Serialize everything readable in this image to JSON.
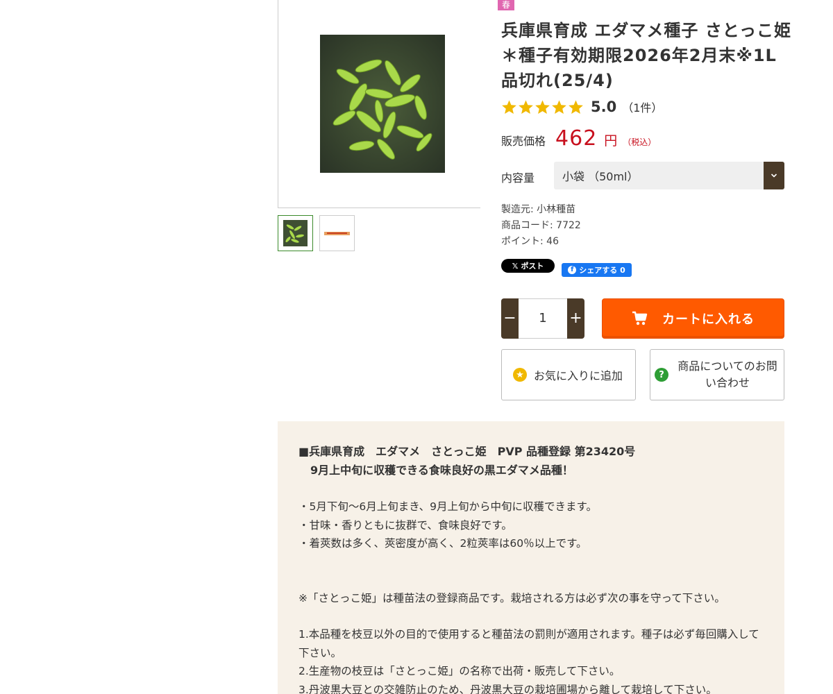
{
  "season_badge": "春",
  "product": {
    "title": "兵庫県育成 エダマメ種子 さとっこ姫＊種子有効期限2026年2月末※1L品切れ(25/4)",
    "rating": {
      "stars": 5,
      "score": "5.0",
      "count": "（1件）"
    },
    "price": {
      "label": "販売価格",
      "value": "462",
      "unit": "円",
      "tax": "（税込）"
    },
    "volume": {
      "label": "内容量",
      "selected": "小袋 （50ml）"
    },
    "maker": "製造元: 小林種苗",
    "code": "商品コード: 7722",
    "point": "ポイント: 46"
  },
  "social": {
    "x_post": "ポスト",
    "fb_share": "シェアする 0"
  },
  "cart": {
    "quantity": "1",
    "minus": "−",
    "plus": "+",
    "add_to_cart": "カートに入れる"
  },
  "actions": {
    "favorite": "お気に入りに追加",
    "inquiry": "商品についてのお問い合わせ"
  },
  "description": {
    "heading_1": "■兵庫県育成　エダマメ　さとっこ姫　PVP 品種登録 第23420号",
    "heading_2": "9月上中旬に収穫できる食味良好の黒エダマメ品種！",
    "points": [
      "・5月下旬～6月上旬まき、9月上旬から中旬に収穫できます。",
      "・甘味・香りともに抜群で、食味良好です。",
      "・着莢数は多く、莢密度が高く、2粒莢率は60％以上です。"
    ],
    "note": "※「さとっこ姫」は種苗法の登録商品です。栽培される方は必ず次の事を守って下さい。",
    "rules": [
      "1.本品種を枝豆以外の目的で使用すると種苗法の罰則が適用されます。種子は必ず毎回購入して下さい。",
      "2.生産物の枝豆は「さとっこ姫」の名称で出荷・販売して下さい。",
      "3.丹波黒大豆との交雑防止のため、丹波黒大豆の栽培圃場から離して栽培して下さい。"
    ]
  },
  "colors": {
    "price_red": "#c8101e",
    "cart_orange": "#ff5a00",
    "brown": "#4a3a28",
    "description_bg": "#f7f1e8",
    "star_gold": "#f0b800"
  }
}
